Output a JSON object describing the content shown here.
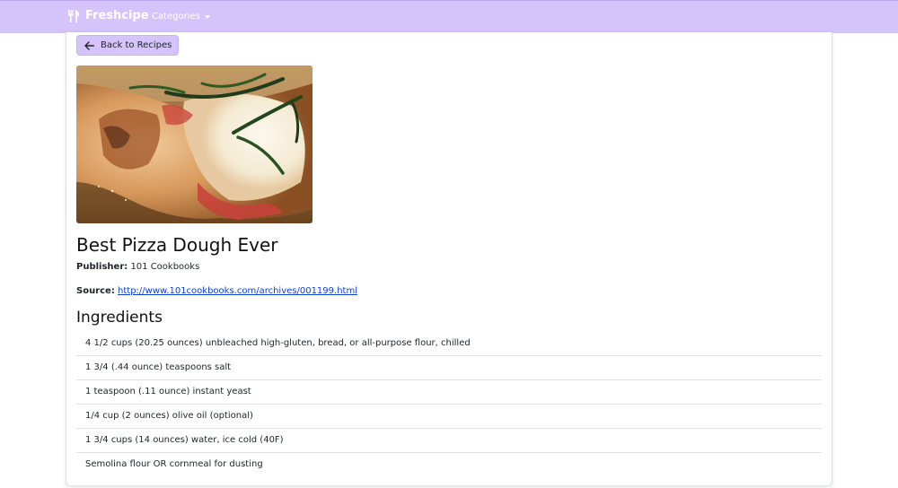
{
  "navbar": {
    "brand": "Freshcipe",
    "brand_icon": "utensils-icon",
    "categories_label": "Categories",
    "bg_color": "#d4c4fb"
  },
  "recipe": {
    "back_label": "Back to Recipes",
    "title": "Best Pizza Dough Ever",
    "publisher_label": "Publisher:",
    "publisher": "101 Cookbooks",
    "source_label": "Source:",
    "source_url": "http://www.101cookbooks.com/archives/001199.html",
    "image_subject": "pizza-photo"
  },
  "ingredients_title": "Ingredients",
  "ingredients": [
    "4 1/2 cups (20.25 ounces) unbleached high-gluten, bread, or all-purpose flour, chilled",
    "1 3/4 (.44 ounce) teaspoons salt",
    "1 teaspoon (.11 ounce) instant yeast",
    "1/4 cup (2 ounces) olive oil (optional)",
    "1 3/4 cups (14 ounces) water, ice cold (40F)",
    "Semolina flour OR cornmeal for dusting"
  ]
}
